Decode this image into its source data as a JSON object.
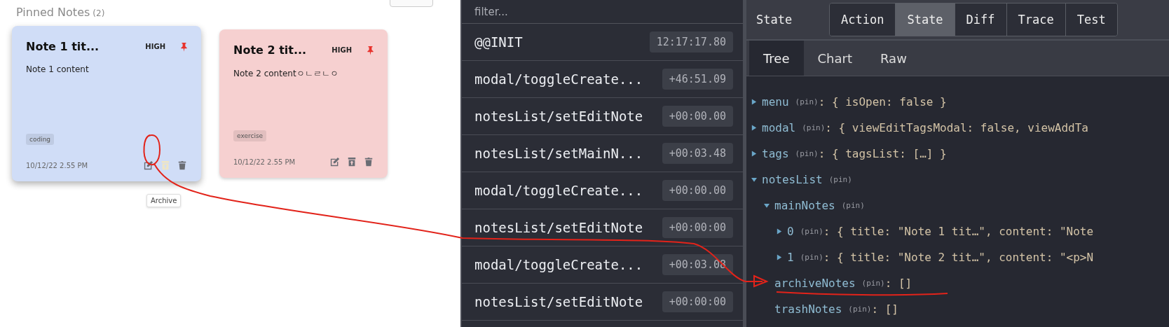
{
  "pinned": {
    "title": "Pinned Notes",
    "count": "(2)"
  },
  "notes": [
    {
      "title": "Note 1 tit...",
      "priority": "HIGH",
      "content": "Note 1 content",
      "tag": "coding",
      "date": "10/12/22 2.55 PM",
      "color": "#d0ddf7",
      "hovered": true,
      "tooltip": "Archive",
      "actions": [
        {
          "kind": "edit",
          "hovered": false
        },
        {
          "kind": "archive",
          "hovered": true
        },
        {
          "kind": "trash",
          "hovered": false
        }
      ]
    },
    {
      "title": "Note 2 tit...",
      "priority": "HIGH",
      "content": "Note 2 contentㅇㄴㄹㄴㅇ",
      "tag": "exercise",
      "date": "10/12/22 2.55 PM",
      "color": "#f6d0d0",
      "hovered": false,
      "actions": [
        {
          "kind": "edit",
          "hovered": false
        },
        {
          "kind": "archive",
          "hovered": false
        },
        {
          "kind": "trash",
          "hovered": false
        }
      ]
    }
  ],
  "actions_log": {
    "filter": {
      "placeholder": "filter..."
    },
    "items": [
      {
        "name": "@@INIT",
        "time": "12:17:17.80"
      },
      {
        "name": "modal/toggleCreate...",
        "time": "+46:51.09"
      },
      {
        "name": "notesList/setEditNote",
        "time": "+00:00.00"
      },
      {
        "name": "notesList/setMainN...",
        "time": "+00:03.48"
      },
      {
        "name": "modal/toggleCreate...",
        "time": "+00:00.00"
      },
      {
        "name": "notesList/setEditNote",
        "time": "+00:00:00"
      },
      {
        "name": "modal/toggleCreate...",
        "time": "+00:03.08"
      },
      {
        "name": "notesList/setEditNote",
        "time": "+00:00:00"
      }
    ]
  },
  "inspector": {
    "label": "State",
    "modes": [
      {
        "label": "Action",
        "selected": false
      },
      {
        "label": "State",
        "selected": true
      },
      {
        "label": "Diff",
        "selected": false
      },
      {
        "label": "Trace",
        "selected": false
      },
      {
        "label": "Test",
        "selected": false
      }
    ],
    "tabs": [
      {
        "label": "Tree",
        "selected": true
      },
      {
        "label": "Chart",
        "selected": false
      },
      {
        "label": "Raw",
        "selected": false
      }
    ],
    "tree": [
      {
        "key": "menu",
        "pin": "(pin)",
        "value": ": { isOpen: false }",
        "kind": "branch",
        "expanded": false
      },
      {
        "key": "modal",
        "pin": "(pin)",
        "value": ": { viewEditTagsModal: false, viewAddTa",
        "kind": "branch",
        "expanded": false
      },
      {
        "key": "tags",
        "pin": "(pin)",
        "value": ": { tagsList: […] }",
        "kind": "branch",
        "expanded": false
      },
      {
        "key": "notesList",
        "pin": "(pin)",
        "kind": "branch",
        "expanded": true,
        "children": [
          {
            "key": "mainNotes",
            "pin": "(pin)",
            "kind": "branch",
            "expanded": true,
            "children": [
              {
                "key": "0",
                "pin": "(pin)",
                "value": ": { title: \"Note 1 tit…\", content: \"Note",
                "kind": "branch",
                "expanded": false
              },
              {
                "key": "1",
                "pin": "(pin)",
                "value": ": { title: \"Note 2 tit…\", content: \"<p>N",
                "kind": "branch",
                "expanded": false
              }
            ]
          },
          {
            "key": "archiveNotes",
            "pin": "(pin)",
            "value": ": []",
            "kind": "leaf"
          },
          {
            "key": "trashNotes",
            "pin": "(pin)",
            "value": ": []",
            "kind": "leaf"
          }
        ]
      }
    ]
  }
}
